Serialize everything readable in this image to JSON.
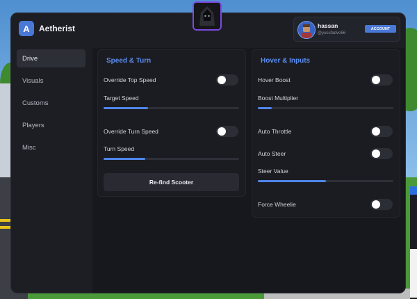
{
  "app": {
    "logo_letter": "A",
    "title": "Aetherist",
    "accent_color": "#4a78d6"
  },
  "account": {
    "name": "hassan",
    "username": "@yusufadvo56",
    "button_label": "ACCOUNT"
  },
  "sidebar": {
    "items": [
      {
        "label": "Drive",
        "active": true
      },
      {
        "label": "Visuals",
        "active": false
      },
      {
        "label": "Customs",
        "active": false
      },
      {
        "label": "Players",
        "active": false
      },
      {
        "label": "Misc",
        "active": false
      }
    ]
  },
  "speed_turn": {
    "title": "Speed & Turn",
    "override_top_speed": {
      "label": "Override Top Speed",
      "enabled": false
    },
    "target_speed": {
      "label": "Target Speed",
      "value": 0.33
    },
    "override_turn_speed": {
      "label": "Override Turn Speed",
      "enabled": false
    },
    "turn_speed": {
      "label": "Turn Speed",
      "value": 0.31
    },
    "refind_button": "Re-find Scooter"
  },
  "hover_inputs": {
    "title": "Hover & Inputs",
    "hover_boost": {
      "label": "Hover Boost",
      "enabled": false
    },
    "boost_multiplier": {
      "label": "Boost Multiplier",
      "value": 0.1
    },
    "auto_throttle": {
      "label": "Auto Throttle",
      "enabled": false
    },
    "auto_steer": {
      "label": "Auto Steer",
      "enabled": false
    },
    "steer_value": {
      "label": "Steer Value",
      "value": 0.5
    },
    "force_wheelie": {
      "label": "Force Wheelie",
      "enabled": false
    }
  }
}
